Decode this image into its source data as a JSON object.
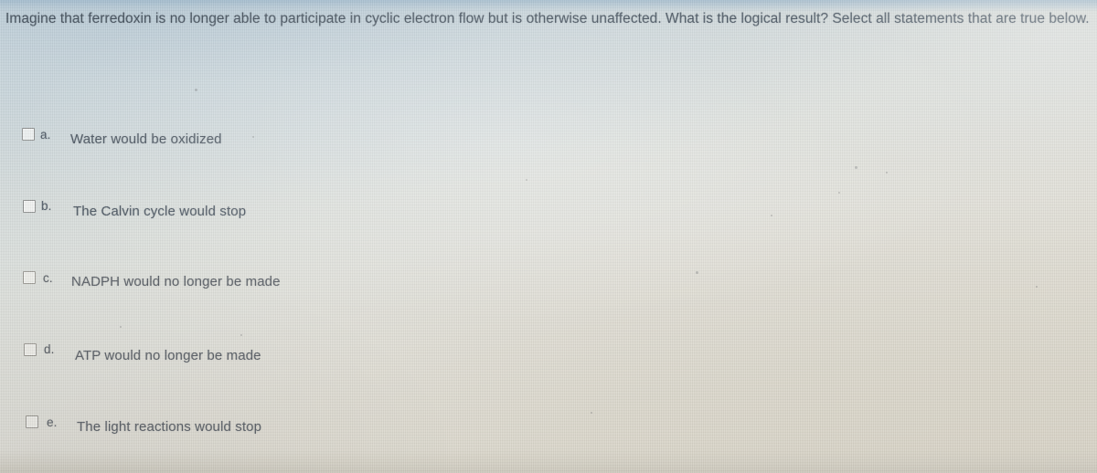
{
  "question": {
    "text": "Imagine that ferredoxin is no longer able to participate in cyclic electron flow but is otherwise unaffected. What is the logical result? Select all statements that are true below."
  },
  "options": [
    {
      "letter": "a.",
      "text": "Water would be oxidized",
      "checked": false,
      "checkbox_icon": "unchecked-checkbox-icon"
    },
    {
      "letter": "b.",
      "text": "The Calvin cycle would stop",
      "checked": false,
      "checkbox_icon": "unchecked-checkbox-icon"
    },
    {
      "letter": "c.",
      "text": "NADPH would no longer be made",
      "checked": false,
      "checkbox_icon": "unchecked-checkbox-icon"
    },
    {
      "letter": "d.",
      "text": "ATP would no longer be made",
      "checked": false,
      "checkbox_icon": "unchecked-checkbox-icon"
    },
    {
      "letter": "e.",
      "text": "The light reactions would stop",
      "checked": false,
      "checkbox_icon": "unchecked-checkbox-icon"
    }
  ],
  "colors": {
    "question_text": "#45525e",
    "option_text_cool": "#47525d",
    "option_text_warm": "#5b6067",
    "checkbox_border": "#8d8f8e",
    "background_cool": "#c3d3dc",
    "background_warm": "#d9d5c9"
  }
}
